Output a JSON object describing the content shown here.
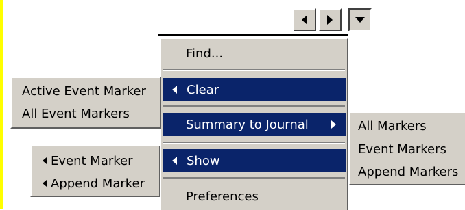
{
  "toolbar": {
    "prev_icon": "triangle-left-icon",
    "next_icon": "triangle-right-icon",
    "menu_icon": "triangle-down-icon"
  },
  "main_menu": {
    "find": "Find...",
    "clear": "Clear",
    "summary": "Summary to Journal",
    "show": "Show",
    "preferences": "Preferences"
  },
  "clear_submenu": {
    "active": "Active Event Marker",
    "all": "All Event Markers"
  },
  "show_submenu": {
    "event": "Event Marker",
    "append": "Append Marker"
  },
  "summary_submenu": {
    "all": "All Markers",
    "event": "Event Markers",
    "append": "Append Markers"
  },
  "colors": {
    "menu_bg": "#d4d0c8",
    "highlight": "#0a246a",
    "edge": "#ffff00"
  }
}
